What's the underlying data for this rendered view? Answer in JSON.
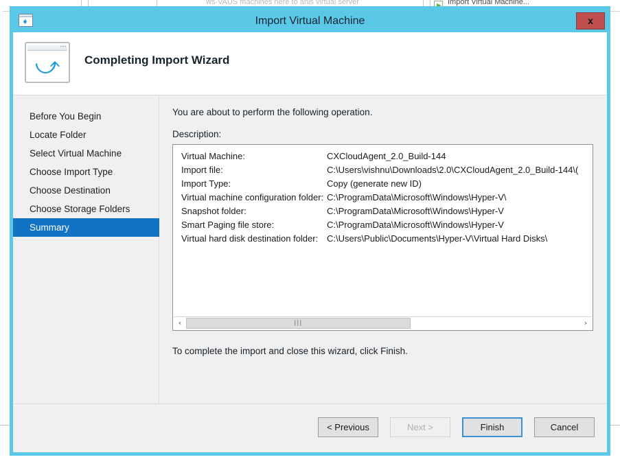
{
  "background": {
    "taskbar_text": "ws-VAUS macnines nere to anis virtual server",
    "menu_item": "Import Virtual Machine...",
    "menu_icon": "import-vm-green-arrow-icon"
  },
  "dialog": {
    "title": "Import Virtual Machine",
    "title_icon": "import-wizard-window-icon",
    "close_label": "x",
    "accent_color": "#5cc8e8",
    "close_color": "#c0504d"
  },
  "header": {
    "heading": "Completing Import Wizard",
    "icon": "wizard-window-arrow-icon",
    "icon_dots": "•••"
  },
  "sidebar": {
    "items": [
      {
        "label": "Before You Begin",
        "active": false
      },
      {
        "label": "Locate Folder",
        "active": false
      },
      {
        "label": "Select Virtual Machine",
        "active": false
      },
      {
        "label": "Choose Import Type",
        "active": false
      },
      {
        "label": "Choose Destination",
        "active": false
      },
      {
        "label": "Choose Storage Folders",
        "active": false
      },
      {
        "label": "Summary",
        "active": true
      }
    ],
    "active_color": "#1273c4"
  },
  "content": {
    "lead": "You are about to perform the following operation.",
    "description_label": "Description:",
    "rows": [
      {
        "key": "Virtual Machine:",
        "value": "CXCloudAgent_2.0_Build-144"
      },
      {
        "key": "Import file:",
        "value": "C:\\Users\\vishnu\\Downloads\\2.0\\CXCloudAgent_2.0_Build-144\\("
      },
      {
        "key": "Import Type:",
        "value": "Copy (generate new ID)"
      },
      {
        "key": "Virtual machine configuration folder:",
        "value": "C:\\ProgramData\\Microsoft\\Windows\\Hyper-V\\"
      },
      {
        "key": "Snapshot folder:",
        "value": "C:\\ProgramData\\Microsoft\\Windows\\Hyper-V"
      },
      {
        "key": "Smart Paging file store:",
        "value": "C:\\ProgramData\\Microsoft\\Windows\\Hyper-V"
      },
      {
        "key": "Virtual hard disk destination folder:",
        "value": "C:\\Users\\Public\\Documents\\Hyper-V\\Virtual Hard Disks\\"
      }
    ],
    "scrollbar": {
      "left_arrow": "‹",
      "right_arrow": "›",
      "grip": "|||"
    },
    "closing_text": "To complete the import and close this wizard, click Finish."
  },
  "footer": {
    "buttons": [
      {
        "label": "< Previous",
        "state": "enabled"
      },
      {
        "label": "Next >",
        "state": "disabled"
      },
      {
        "label": "Finish",
        "state": "focused"
      },
      {
        "label": "Cancel",
        "state": "enabled"
      }
    ]
  }
}
